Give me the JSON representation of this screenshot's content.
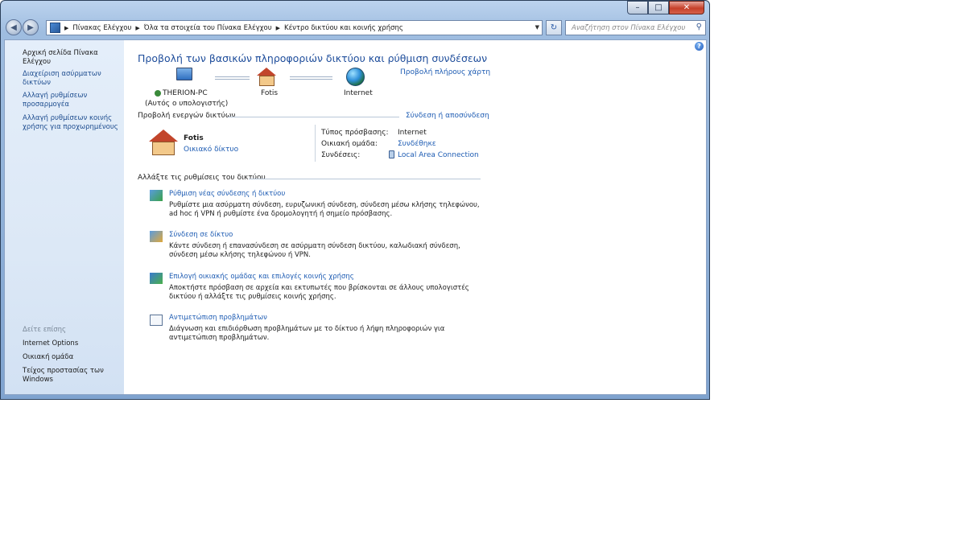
{
  "titlebar": {
    "min": "–",
    "max": "□",
    "close": "✕"
  },
  "nav": {
    "back": "◀",
    "forward": "▶",
    "breadcrumb": [
      "Πίνακας Ελέγχου",
      "Όλα τα στοιχεία του Πίνακα Ελέγχου",
      "Κέντρο δικτύου και κοινής χρήσης"
    ],
    "refresh": "↻",
    "search_placeholder": "Αναζήτηση στον Πίνακα Ελέγχου",
    "search_icon": "⚲"
  },
  "sidebar": {
    "home": "Αρχική σελίδα Πίνακα Ελέγχου",
    "items": [
      "Διαχείριση ασύρματων δικτύων",
      "Αλλαγή ρυθμίσεων προσαρμογέα",
      "Αλλαγή ρυθμίσεων κοινής χρήσης για προχωρημένους"
    ],
    "see_also": "Δείτε επίσης",
    "see_also_items": [
      "Internet Options",
      "Οικιακή ομάδα",
      "Τείχος προστασίας των Windows"
    ]
  },
  "main": {
    "title": "Προβολή των βασικών πληροφοριών δικτύου και ρύθμιση συνδέσεων",
    "full_map": "Προβολή πλήρους χάρτη",
    "map": {
      "pc_name": "THERION-PC",
      "pc_sub": "(Αυτός ο υπολογιστής)",
      "network": "Fotis",
      "internet": "Internet"
    },
    "active_header": "Προβολή ενεργών δικτύων",
    "connect_disconnect": "Σύνδεση ή αποσύνδεση",
    "active": {
      "name": "Fotis",
      "type": "Οικιακό δίκτυο",
      "access_label": "Τύπος πρόσβασης:",
      "access_value": "Internet",
      "homegroup_label": "Οικιακή ομάδα:",
      "homegroup_value": "Συνδέθηκε",
      "connections_label": "Συνδέσεις:",
      "connections_value": "Local Area Connection"
    },
    "change_header": "Αλλάξτε τις ρυθμίσεις του δικτύου",
    "tasks": [
      {
        "title": "Ρύθμιση νέας σύνδεσης ή δικτύου",
        "desc": "Ρυθμίστε μια ασύρματη σύνδεση, ευρυζωνική σύνδεση, σύνδεση μέσω κλήσης τηλεφώνου, ad hoc ή VPN ή ρυθμίστε ένα δρομολογητή ή σημείο πρόσβασης."
      },
      {
        "title": "Σύνδεση σε δίκτυο",
        "desc": "Κάντε σύνδεση ή επανασύνδεση σε ασύρματη σύνδεση δικτύου, καλωδιακή σύνδεση, σύνδεση μέσω κλήσης τηλεφώνου ή VPN."
      },
      {
        "title": "Επιλογή οικιακής ομάδας και επιλογές κοινής χρήσης",
        "desc": "Αποκτήστε πρόσβαση σε αρχεία και εκτυπωτές που βρίσκονται σε άλλους υπολογιστές δικτύου ή αλλάξτε τις ρυθμίσεις κοινής χρήσης."
      },
      {
        "title": "Αντιμετώπιση προβλημάτων",
        "desc": "Διάγνωση και επιδιόρθωση προβλημάτων με το δίκτυο ή λήψη πληροφοριών για αντιμετώπιση προβλημάτων."
      }
    ]
  },
  "help": "?"
}
